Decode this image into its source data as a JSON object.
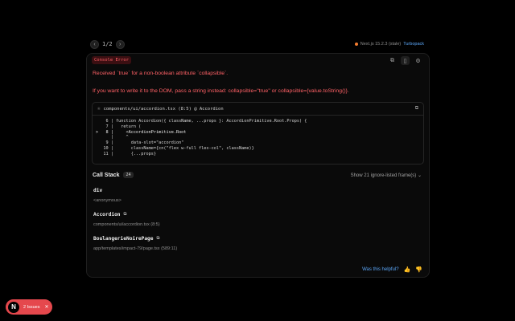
{
  "nav": {
    "prev_icon": "chevron-left-icon",
    "next_icon": "chevron-right-icon",
    "pager": "1/2",
    "version": "Next.js 15.2.3 (stale)",
    "bundler": "Turbopack",
    "status_color": "#f47c2f"
  },
  "error": {
    "badge": "Console Error",
    "message": "Received `true` for a non-boolean attribute `collapsible`.",
    "hint": "If you want to write it to the DOM, pass a string instead: collapsible=\"true\" or collapsible={value.toString()}.",
    "accent_color": "#ff6166"
  },
  "toolbar": {
    "copy_icon": "copy-icon",
    "docs_icon": "book-icon",
    "settings_icon": "gear-icon"
  },
  "code": {
    "file": "components/ui/accordion.tsx (8:5) @ Accordion",
    "lines": [
      "    6 | function Accordion({ className, ...props }: AccordionPrimitive.Root.Props) {",
      "    7 |   return (",
      ">   8 |     <AccordionPrimitive.Root",
      "      |     ^",
      "    9 |       data-slot=\"accordion\"",
      "   10 |       className={cn(\"flex w-full flex-col\", className)}",
      "   11 |       {...props}"
    ]
  },
  "callstack": {
    "title": "Call Stack",
    "count": "24",
    "toggle": "Show 21 ignore-listed frame(s) ⌄",
    "frames": [
      {
        "name": "div",
        "location": "<anonymous>"
      },
      {
        "name": "Accordion",
        "location": "components/ui/accordion.tsx (8:5)"
      },
      {
        "name": "BoulangerieNoirePage",
        "location": "app/templates/impact-79/page.tsx (589:11)"
      }
    ]
  },
  "footer": {
    "helpful": "Was this helpful?",
    "thumbs_up": "👍",
    "thumbs_down": "👎"
  },
  "issues": {
    "logo": "N",
    "label": "2 Issues",
    "close": "✕",
    "color": "#e5484d"
  }
}
